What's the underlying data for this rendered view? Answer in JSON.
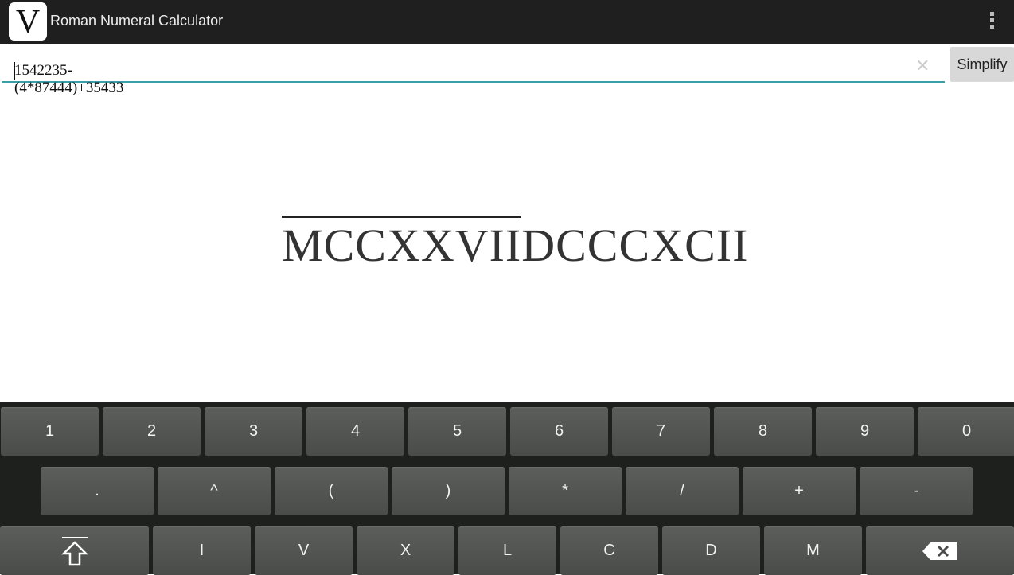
{
  "app": {
    "title": "Roman Numeral Calculator",
    "logo_letter": "V"
  },
  "input": {
    "value": "1542235-(4*87444)+35433"
  },
  "simplify_label": "Simplify",
  "result": {
    "overlined": "MCCXXVII",
    "rest": "DCCCXCII"
  },
  "keyboard": {
    "row1": [
      "1",
      "2",
      "3",
      "4",
      "5",
      "6",
      "7",
      "8",
      "9",
      "0"
    ],
    "row2": [
      ".",
      "^",
      "(",
      ")",
      "*",
      "/",
      "+",
      "-"
    ],
    "row3": [
      "I",
      "V",
      "X",
      "L",
      "C",
      "D",
      "M"
    ]
  },
  "icons": {
    "menu": "overflow-menu-icon",
    "clear": "clear-x-icon",
    "shift": "shift-arrow-icon",
    "backspace": "backspace-icon"
  }
}
